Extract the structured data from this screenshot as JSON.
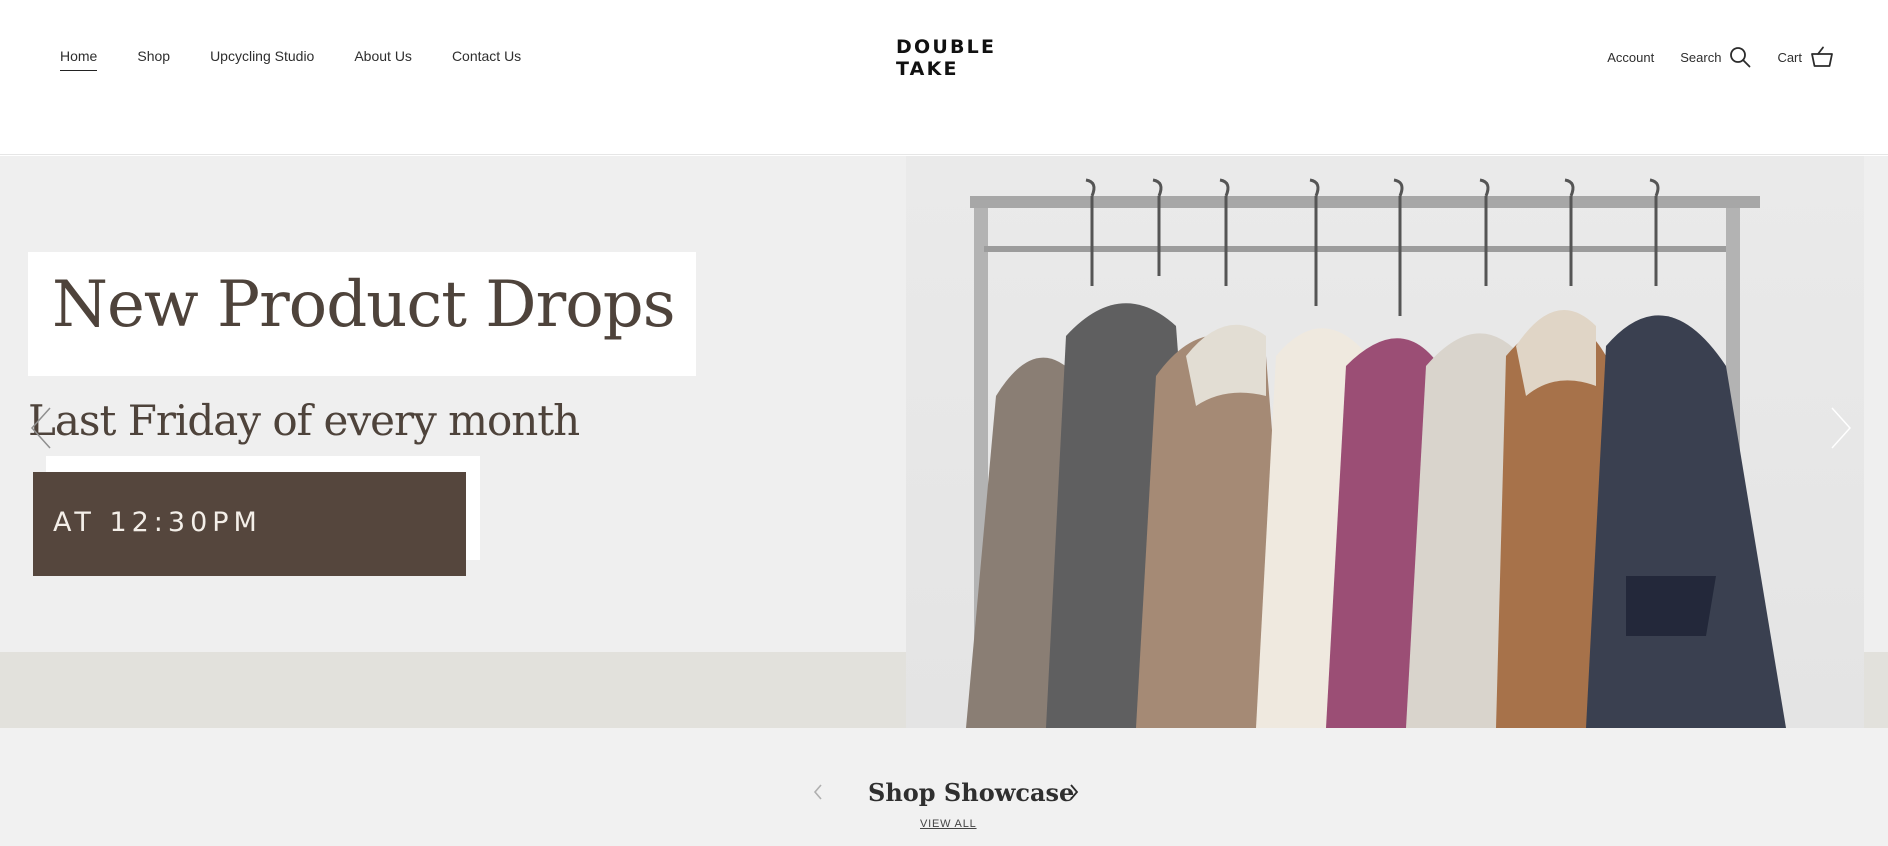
{
  "header": {
    "nav": [
      {
        "label": "Home",
        "active": true
      },
      {
        "label": "Shop",
        "active": false
      },
      {
        "label": "Upcycling Studio",
        "active": false
      },
      {
        "label": "About Us",
        "active": false
      },
      {
        "label": "Contact Us",
        "active": false
      }
    ],
    "logo_line1": "DOUBLE",
    "logo_line2": "TAKE",
    "account_label": "Account",
    "search_label": "Search",
    "cart_label": "Cart"
  },
  "hero": {
    "title": "New Product Drops",
    "subtitle": "Last Friday of every month",
    "time_label": "AT 12:30PM",
    "colors": {
      "accent_brown": "#55463d",
      "text_brown": "#4e433b",
      "band": "#e2e1dc"
    }
  },
  "showcase": {
    "title": "Shop Showcase",
    "view_all_label": "VIEW ALL"
  },
  "icons": [
    "search-icon",
    "cart-icon",
    "chevron-left-icon",
    "chevron-right-icon"
  ]
}
